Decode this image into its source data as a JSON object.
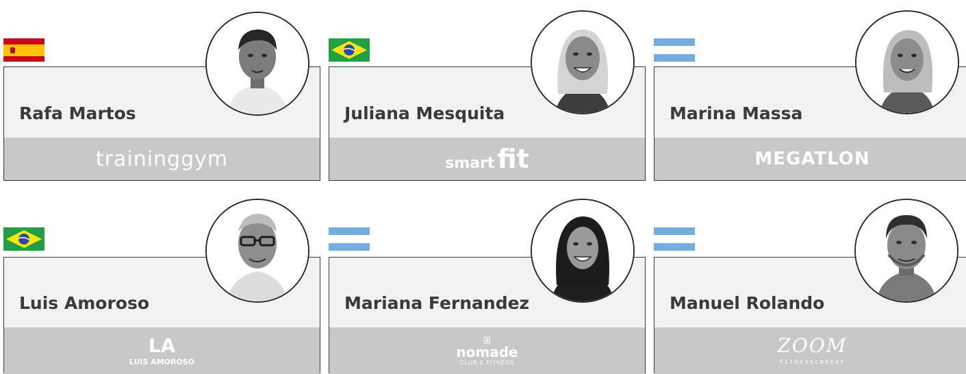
{
  "colors": {
    "border": "#3a3a3a",
    "card_bg": "#f2f2f2",
    "brand_bar_bg": "#c8c8c8",
    "name_text": "#3a3a3a",
    "brand_text": "#ffffff"
  },
  "people": [
    {
      "name": "Rafa Martos",
      "country_flag": "spain-flag",
      "photo": "avatar-photo",
      "brand": {
        "text": "traininggym"
      }
    },
    {
      "name": "Juliana Mesquita",
      "country_flag": "brazil-flag",
      "photo": "avatar-photo",
      "brand": {
        "text": "smart",
        "text2": "fit"
      }
    },
    {
      "name": "Marina Massa",
      "country_flag": "argentina-flag",
      "photo": "avatar-photo",
      "brand": {
        "text": "MEGATLON"
      }
    },
    {
      "name": "Luis Amoroso",
      "country_flag": "brazil-flag",
      "photo": "avatar-photo",
      "brand": {
        "mark": "LA",
        "text": "LUIS AMOROSO"
      }
    },
    {
      "name": "Mariana Fernandez",
      "country_flag": "argentina-flag",
      "photo": "avatar-photo",
      "brand": {
        "mark": "ꕤ",
        "text": "nomade",
        "sub": "CLUB & FITNESS"
      }
    },
    {
      "name": "Manuel Rolando",
      "country_flag": "argentina-flag",
      "photo": "avatar-photo",
      "brand": {
        "text": "ZOOM",
        "sub": "fitnesscenter"
      }
    }
  ]
}
